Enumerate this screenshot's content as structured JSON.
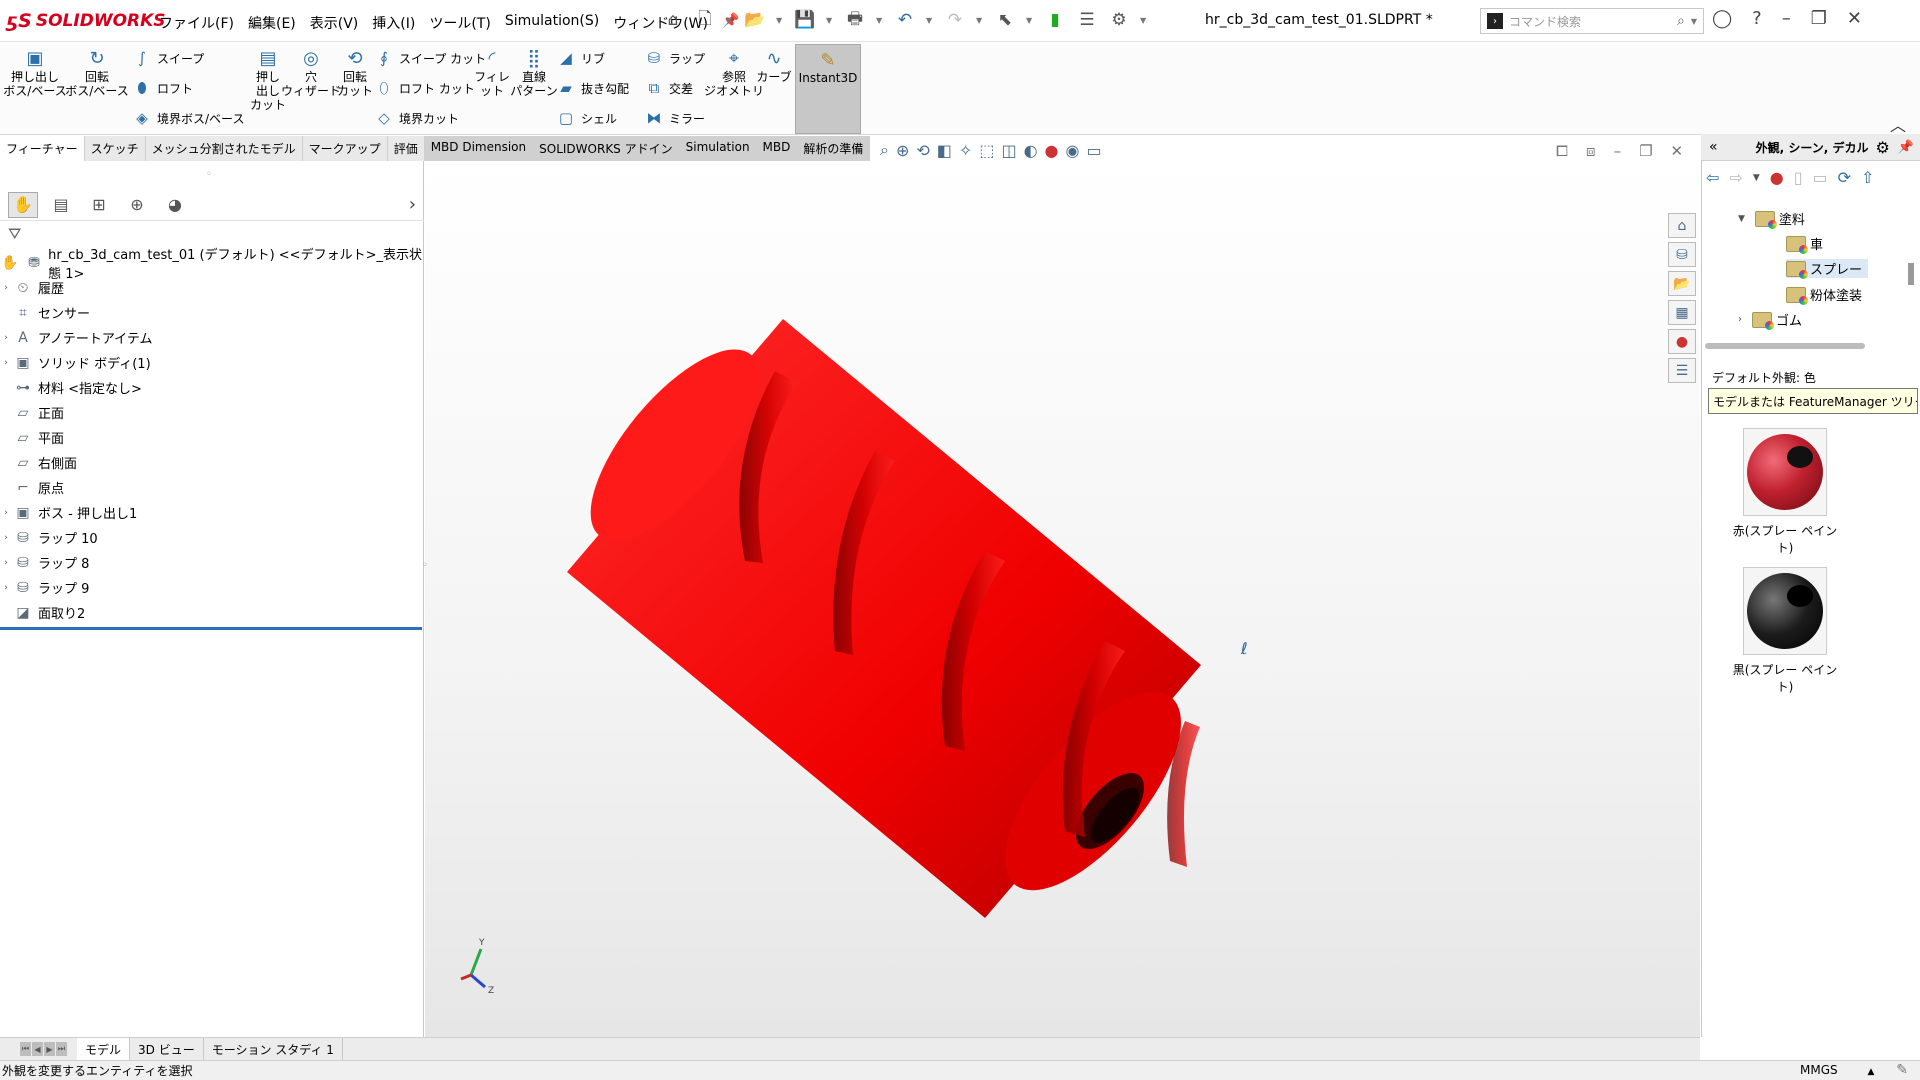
{
  "app": {
    "brand": "SOLIDWORKS",
    "brand_color": "#d6001c"
  },
  "menu": [
    "ファイル(F)",
    "編集(E)",
    "表示(V)",
    "挿入(I)",
    "ツール(T)",
    "Simulation(S)",
    "ウィンドウ(W)"
  ],
  "document": {
    "title": "hr_cb_3d_cam_test_01.SLDPRT *"
  },
  "search": {
    "placeholder": "コマンド検索"
  },
  "commands": {
    "extrude_boss": "押し出し\nボス/ベース",
    "revolve_boss": "回転\nボス/ベース",
    "sweep": "スイープ",
    "loft": "ロフト",
    "boundary_boss": "境界ボス/ベース",
    "extrude_cut": "押し\n出し\nカット",
    "hole_wizard": "穴\nウィザード",
    "revolve_cut": "回転\nカット",
    "sweep_cut": "スイープ カット",
    "loft_cut": "ロフト カット",
    "boundary_cut": "境界カット",
    "fillet": "フィレット",
    "linear_pattern": "直線\nパターン",
    "rib": "リブ",
    "draft": "抜き勾配",
    "shell": "シェル",
    "wrap": "ラップ",
    "intersect": "交差",
    "mirror": "ミラー",
    "ref_geometry": "参照\nジオメトリ",
    "curves": "カーブ",
    "instant3d": "Instant3D"
  },
  "tabs": [
    "フィーチャー",
    "スケッチ",
    "メッシュ分割されたモデル",
    "マークアップ",
    "評価",
    "MBD Dimension",
    "SOLIDWORKS アドイン",
    "Simulation",
    "MBD",
    "解析の準備"
  ],
  "feature_tree": {
    "root": "hr_cb_3d_cam_test_01 (デフォルト) <<デフォルト>_表示状態 1>",
    "nodes": [
      {
        "label": "履歴",
        "icon": "history-icon",
        "expandable": true
      },
      {
        "label": "センサー",
        "icon": "sensor-icon",
        "expandable": false
      },
      {
        "label": "アノテートアイテム",
        "icon": "annotation-icon",
        "expandable": true
      },
      {
        "label": "ソリッド ボディ(1)",
        "icon": "solid-body-icon",
        "expandable": true
      },
      {
        "label": "材料 <指定なし>",
        "icon": "material-icon",
        "expandable": false
      },
      {
        "label": "正面",
        "icon": "plane-icon",
        "expandable": false
      },
      {
        "label": "平面",
        "icon": "plane-icon",
        "expandable": false
      },
      {
        "label": "右側面",
        "icon": "plane-icon",
        "expandable": false
      },
      {
        "label": "原点",
        "icon": "origin-icon",
        "expandable": false
      },
      {
        "label": "ボス - 押し出し1",
        "icon": "extrude-icon",
        "expandable": true
      },
      {
        "label": "ラップ 10",
        "icon": "wrap-icon",
        "expandable": true
      },
      {
        "label": "ラップ 8",
        "icon": "wrap-icon",
        "expandable": true
      },
      {
        "label": "ラップ 9",
        "icon": "wrap-icon",
        "expandable": true
      },
      {
        "label": "面取り2",
        "icon": "chamfer-icon",
        "expandable": false
      }
    ]
  },
  "task_pane": {
    "title": "外観, シーン, デカル",
    "tree": [
      {
        "label": "塗料",
        "level": 1,
        "expanded": true
      },
      {
        "label": "車",
        "level": 2
      },
      {
        "label": "スプレー",
        "level": 2,
        "selected": true
      },
      {
        "label": "粉体塗装",
        "level": 2
      },
      {
        "label": "ゴム",
        "level": 1,
        "expanded": false
      }
    ],
    "default_label": "デフォルト外観: 色",
    "tooltip": "モデルまたは FeatureManager ツリーに...",
    "swatches": [
      {
        "label": "赤(スプレー ペイント)",
        "color": "#c0202e"
      },
      {
        "label": "黒(スプレー ペイント)",
        "color": "#1c1c1c"
      }
    ]
  },
  "model": {
    "color": "#ff1a1a",
    "shade": "#c80000"
  },
  "triad": {
    "y": "Y",
    "z": "Z"
  },
  "bottom_tabs": [
    "モデル",
    "3D ビュー",
    "モーション スタディ 1"
  ],
  "status": {
    "message": "外観を変更するエンティティを選択",
    "units": "MMGS"
  }
}
